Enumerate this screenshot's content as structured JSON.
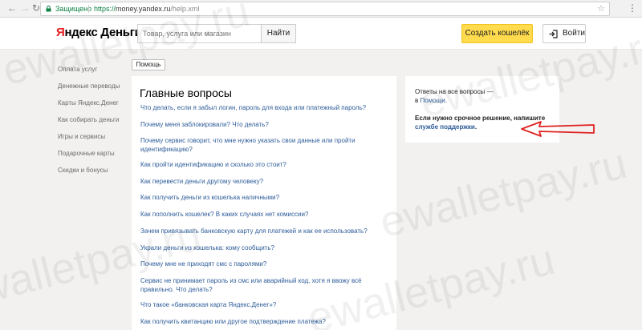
{
  "browser": {
    "secure_label": "Защищено",
    "url_protocol": "https://",
    "url_host": "money.yandex.ru",
    "url_path": "/help.xml"
  },
  "header": {
    "logo_y": "Я",
    "logo_rest": "ндекс Деньги",
    "search_placeholder": "Товар, услуга или магазин",
    "search_button": "Найти",
    "create_wallet_button": "Создать кошелёк",
    "login_button": "Войти"
  },
  "sidebar": {
    "items": [
      {
        "label": "Оплата услуг"
      },
      {
        "label": "Денежные переводы"
      },
      {
        "label": "Карты Яндекс.Денег"
      },
      {
        "label": "Как собирать деньги"
      },
      {
        "label": "Игры и сервисы"
      },
      {
        "label": "Подарочные карты"
      },
      {
        "label": "Скидки и бонусы"
      }
    ]
  },
  "breadcrumb": {
    "help_tag": "Помощь"
  },
  "main": {
    "title": "Главные вопросы",
    "questions": [
      "Что делать, если я забыл логин, пароль для входа или платежный пароль?",
      "Почему меня заблокировали? Что делать?",
      "Почему сервис говорит, что мне нужно указать свои данные или пройти идентификацию?",
      "Как пройти идентификацию и сколько это стоит?",
      "Как перевести деньги другому человеку?",
      "Как получить деньги из кошелька наличными?",
      "Как пополнить кошелек? В каких случаях нет комиссии?",
      "Зачем привязывать банковскую карту для платежей и как ее использовать?",
      "Украли деньги из кошелька: кому сообщить?",
      "Почему мне не приходят смс с паролями?",
      "Сервис не принимает пароль из смс или аварийный код, хотя я ввожу всё правильно. Что делать?",
      "Что такое «банковская карта Яндекс.Денег»?",
      "Как получить квитанцию или другое подтверждение платежа?"
    ]
  },
  "side": {
    "answers_text": "Ответы на все вопросы —",
    "answers_prefix": "в",
    "help_link": "Помощи",
    "urgent_text": "Если нужно срочное решение, напишите",
    "support_link": "службе поддержки"
  },
  "watermark": "ewalletpay.ru",
  "colors": {
    "accent_yellow": "#ffdb4d",
    "link_blue": "#2d5c99",
    "arrow_red": "#e02020",
    "secure_green": "#0b8043"
  }
}
